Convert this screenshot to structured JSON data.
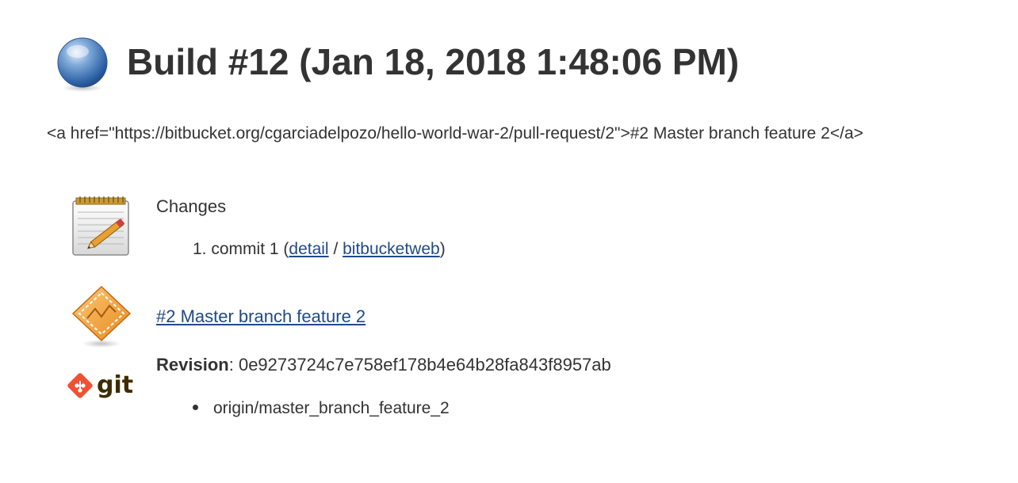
{
  "header": {
    "title": "Build #12 (Jan 18, 2018 1:48:06 PM)",
    "status_icon": "blue-ball-icon"
  },
  "description": "<a href=\"https://bitbucket.org/cgarciadelpozo/hello-world-war-2/pull-request/2\">#2 Master branch feature 2</a>",
  "changes": {
    "heading": "Changes",
    "icon": "notepad-icon",
    "items": [
      {
        "number": "1.",
        "text": "commit 1",
        "open_paren": "(",
        "detail_label": "detail",
        "separator": "/",
        "web_label": "bitbucketweb",
        "close_paren": ")"
      }
    ]
  },
  "pull_request": {
    "icon": "graph-icon",
    "link_label": "#2 Master branch feature 2"
  },
  "git": {
    "icon": "git-logo",
    "logo_text": "git",
    "revision_label": "Revision",
    "revision_sep": ":",
    "revision_value": "0e9273724c7e758ef178b4e64b28fa843f8957ab",
    "branches": [
      "origin/master_branch_feature_2"
    ]
  },
  "colors": {
    "link": "#204a87",
    "text": "#333333",
    "git_orange": "#f05033",
    "git_text": "#3e2c00"
  }
}
